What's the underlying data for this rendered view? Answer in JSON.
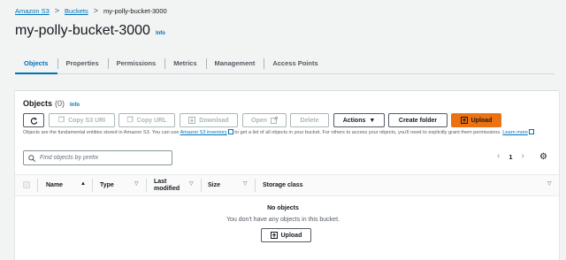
{
  "breadcrumb": {
    "items": [
      "Amazon S3",
      "Buckets"
    ],
    "current": "my-polly-bucket-3000",
    "separator": ">"
  },
  "page": {
    "title": "my-polly-bucket-3000",
    "info": "Info"
  },
  "tabs": [
    {
      "label": "Objects",
      "active": true
    },
    {
      "label": "Properties",
      "active": false
    },
    {
      "label": "Permissions",
      "active": false
    },
    {
      "label": "Metrics",
      "active": false
    },
    {
      "label": "Management",
      "active": false
    },
    {
      "label": "Access Points",
      "active": false
    }
  ],
  "objects": {
    "title": "Objects",
    "count": "(0)",
    "info": "Info",
    "toolbar": {
      "refresh_icon": "refresh-icon",
      "copy_s3_uri": "Copy S3 URI",
      "copy_url": "Copy URL",
      "download": "Download",
      "open": "Open",
      "delete": "Delete",
      "actions": "Actions",
      "create_folder": "Create folder",
      "upload": "Upload"
    },
    "description": {
      "part1": "Objects are the fundamental entities stored in Amazon S3. You can use ",
      "link1": "Amazon S3 inventory",
      "part2": " to get a list of all objects in your bucket. For others to access your objects, you'll need to explicitly grant them permissions. ",
      "link2": "Learn more"
    },
    "search": {
      "placeholder": "Find objects by prefix"
    },
    "pagination": {
      "prev": "‹",
      "page": "1",
      "next": "›"
    },
    "columns": [
      "Name",
      "Type",
      "Last modified",
      "Size",
      "Storage class"
    ],
    "empty": {
      "title": "No objects",
      "message": "You don't have any objects in this bucket.",
      "button": "Upload"
    }
  },
  "colors": {
    "accent": "#0073bb",
    "primary_button": "#ec7211",
    "background": "#f2f3f3"
  }
}
